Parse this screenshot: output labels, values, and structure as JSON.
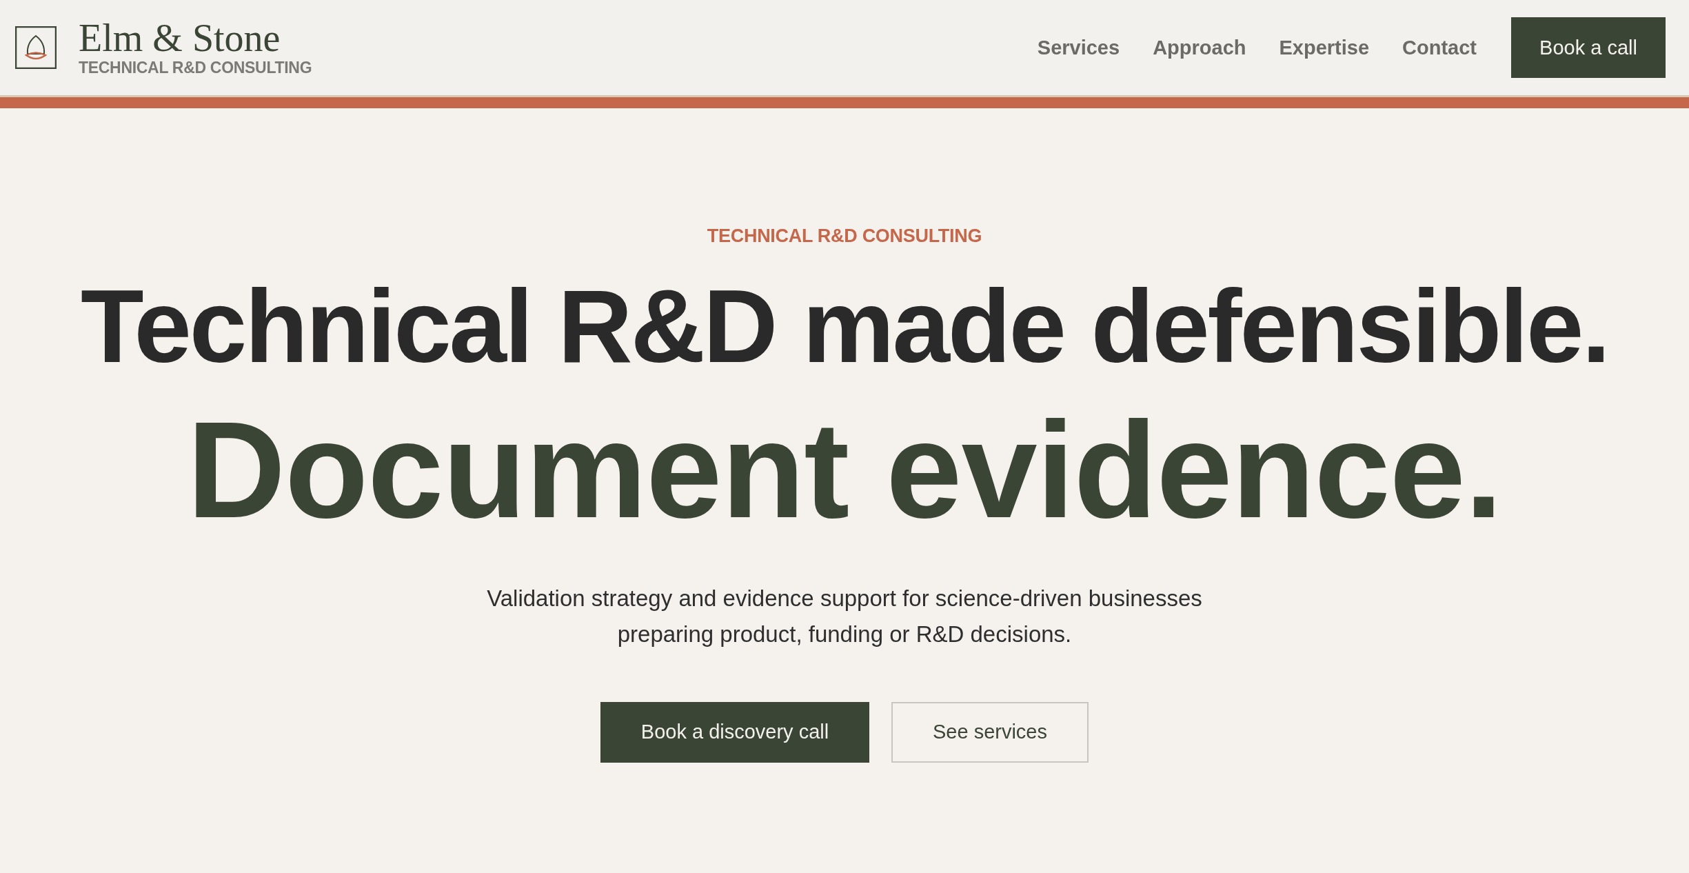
{
  "header": {
    "brand": "Elm & Stone",
    "tagline": "TECHNICAL R&D CONSULTING",
    "nav": [
      "Services",
      "Approach",
      "Expertise",
      "Contact"
    ],
    "cta": "Book a call"
  },
  "hero": {
    "eyebrow": "TECHNICAL R&D CONSULTING",
    "headline": "Technical R&D made defensible.",
    "subheadline": "Document evidence.",
    "description": [
      "Validation strategy and evidence support for science-driven businesses",
      "preparing product, funding or R&D decisions."
    ],
    "buttons": [
      {
        "label": "Book a discovery call",
        "kind": "primary"
      },
      {
        "label": "See services",
        "kind": "secondary"
      }
    ]
  }
}
